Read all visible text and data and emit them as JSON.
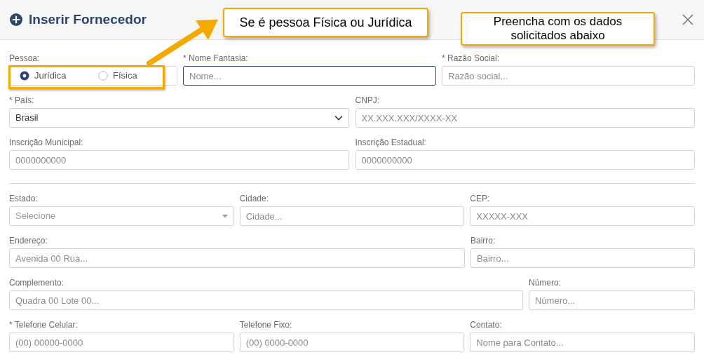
{
  "dialog": {
    "title": "Inserir Fornecedor"
  },
  "callouts": [
    {
      "text": "Se é pessoa Física ou Jurídica",
      "arrow": true,
      "highlight": true
    },
    {
      "text": "Preencha com os dados solicitados abaixo",
      "arrow": false,
      "highlight": false
    }
  ],
  "sections": [
    {
      "rows": [
        {
          "fields": [
            {
              "kind": "radio",
              "label": "Pessoa:",
              "options": [
                {
                  "label": "Jurídica",
                  "selected": true
                },
                {
                  "label": "Física",
                  "selected": false
                }
              ]
            },
            {
              "kind": "text",
              "label": "* Nome Fantasia:",
              "placeholder": "Nome...",
              "focused": true
            },
            {
              "kind": "text",
              "label": "* Razão Social:",
              "placeholder": "Razão social...",
              "focused": false
            }
          ]
        },
        {
          "fields": [
            {
              "kind": "select",
              "label": "* País:",
              "value": "Brasil",
              "focused": false
            },
            {
              "kind": "text",
              "label": "CNPJ:",
              "placeholder": "XX.XXX.XXX/XXXX-XX",
              "focused": false
            }
          ]
        },
        {
          "fields": [
            {
              "kind": "text",
              "label": "Inscrição Municipal:",
              "placeholder": "0000000000",
              "focused": false
            },
            {
              "kind": "text",
              "label": "Inscrição Estadual:",
              "placeholder": "0000000000",
              "focused": false
            }
          ]
        }
      ]
    },
    {
      "rows": [
        {
          "fields": [
            {
              "kind": "combo",
              "label": "Estado:",
              "placeholder": "Selecione",
              "focused": false
            },
            {
              "kind": "text",
              "label": "Cidade:",
              "placeholder": "Cidade...",
              "focused": false
            },
            {
              "kind": "text",
              "label": "CEP:",
              "placeholder": "XXXXX-XXX",
              "focused": false
            }
          ]
        },
        {
          "fields": [
            {
              "kind": "text",
              "label": "Endereço:",
              "placeholder": "Avenida 00 Rua...",
              "focused": false
            },
            {
              "kind": "text",
              "label": "Bairro:",
              "placeholder": "Bairro...",
              "focused": false
            }
          ]
        },
        {
          "fields": [
            {
              "kind": "text",
              "label": "Complemento:",
              "placeholder": "Quadra 00 Lote 00...",
              "focused": false
            },
            {
              "kind": "text",
              "label": "Número:",
              "placeholder": "Número...",
              "focused": false
            }
          ]
        },
        {
          "fields": [
            {
              "kind": "text",
              "label": "* Telefone Celular:",
              "placeholder": "(00) 00000-0000",
              "focused": false
            },
            {
              "kind": "text",
              "label": "Telefone Fixo:",
              "placeholder": "(00) 0000-0000",
              "focused": false
            },
            {
              "kind": "text",
              "label": "Contato:",
              "placeholder": "Nome para Contato...",
              "focused": false
            }
          ]
        }
      ]
    }
  ]
}
